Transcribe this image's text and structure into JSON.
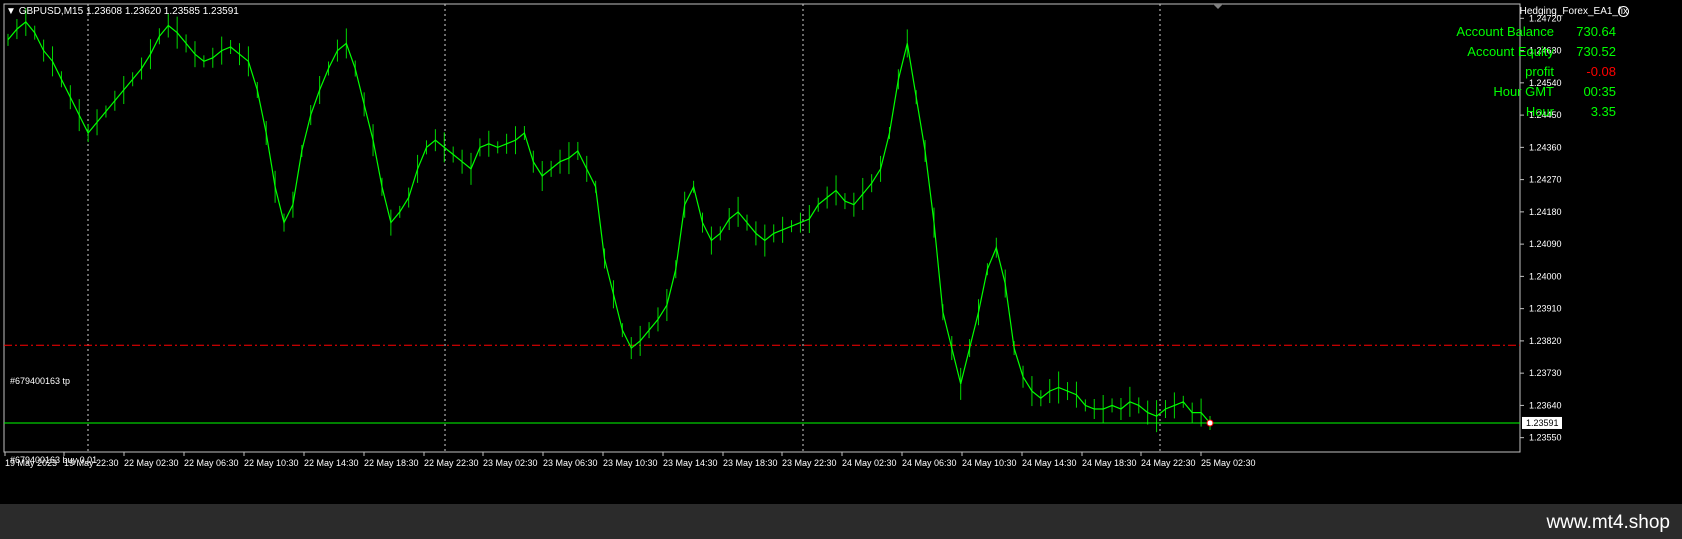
{
  "header": {
    "symbol": "GBPUSD,M15",
    "ohlc": "1.23608 1.23620 1.23585 1.23591",
    "ea_name": "Hedging_Forex_EA1_fix"
  },
  "info_panel": [
    {
      "label": "Account Balance",
      "value": "730.64",
      "negative": false
    },
    {
      "label": "Account Equity",
      "value": "730.52",
      "negative": false
    },
    {
      "label": "profit",
      "value": "-0.08",
      "negative": true
    },
    {
      "label": "Hour GMT",
      "value": "00:35",
      "negative": false
    },
    {
      "label": "Hour",
      "value": "3.35",
      "negative": false
    }
  ],
  "order_labels": {
    "tp": "#679400163 tp",
    "entry": "#679400163 buy 0.01"
  },
  "watermark": "www.mt4.shop",
  "colors": {
    "background": "#000000",
    "candles": "#00ff00",
    "tp_line": "#ff0000",
    "entry_line": "#00ff00",
    "grid": "#c0c0c0",
    "axis_text": "#ffffff"
  },
  "chart_data": {
    "type": "line",
    "title": "",
    "symbol": "GBPUSD",
    "timeframe": "M15",
    "ylim": [
      1.2351,
      1.2476
    ],
    "y_ticks": [
      "1.24720",
      "1.24630",
      "1.24540",
      "1.24450",
      "1.24360",
      "1.24270",
      "1.24180",
      "1.24090",
      "1.24000",
      "1.23910",
      "1.23820",
      "1.23730",
      "1.23640",
      "1.23550"
    ],
    "x_ticks": [
      "19 May 2023",
      "19 May 22:30",
      "22 May 02:30",
      "22 May 06:30",
      "22 May 10:30",
      "22 May 14:30",
      "22 May 18:30",
      "22 May 22:30",
      "23 May 02:30",
      "23 May 06:30",
      "23 May 10:30",
      "23 May 14:30",
      "23 May 18:30",
      "23 May 22:30",
      "24 May 02:30",
      "24 May 06:30",
      "24 May 10:30",
      "24 May 14:30",
      "24 May 18:30",
      "24 May 22:30",
      "25 May 02:30"
    ],
    "session_separators": [
      "19 May 22:30",
      "22 May 22:30",
      "23 May 22:30",
      "24 May 22:30"
    ],
    "current_price": "1.23591",
    "tp_level": 1.23808,
    "entry_level": 1.23591,
    "series": [
      {
        "values": [
          1.2466,
          1.2469,
          1.2471,
          1.2468,
          1.2463,
          1.246,
          1.2455,
          1.245,
          1.2445,
          1.244,
          1.2443,
          1.2446,
          1.2449,
          1.2452,
          1.2455,
          1.2458,
          1.2462,
          1.2467,
          1.247,
          1.2468,
          1.2465,
          1.2462,
          1.246,
          1.2461,
          1.2463,
          1.2464,
          1.2462,
          1.246,
          1.2452,
          1.244,
          1.2425,
          1.2415,
          1.242,
          1.2435,
          1.2445,
          1.2452,
          1.2458,
          1.2463,
          1.2465,
          1.2458,
          1.2448,
          1.2438,
          1.2425,
          1.2415,
          1.2418,
          1.2422,
          1.243,
          1.2436,
          1.2438,
          1.2436,
          1.2434,
          1.2432,
          1.243,
          1.2436,
          1.2437,
          1.2436,
          1.2437,
          1.2438,
          1.244,
          1.2432,
          1.2428,
          1.243,
          1.2432,
          1.2433,
          1.2435,
          1.243,
          1.2425,
          1.2405,
          1.2395,
          1.2385,
          1.238,
          1.2382,
          1.2385,
          1.2388,
          1.2392,
          1.2402,
          1.242,
          1.2425,
          1.2415,
          1.241,
          1.2412,
          1.2416,
          1.2418,
          1.2415,
          1.2412,
          1.241,
          1.2412,
          1.2413,
          1.2414,
          1.2415,
          1.2416,
          1.242,
          1.2422,
          1.2424,
          1.2421,
          1.242,
          1.2423,
          1.2426,
          1.243,
          1.244,
          1.2455,
          1.2465,
          1.245,
          1.2435,
          1.2415,
          1.239,
          1.238,
          1.237,
          1.238,
          1.239,
          1.2402,
          1.2408,
          1.2398,
          1.238,
          1.2372,
          1.2368,
          1.2366,
          1.2368,
          1.2369,
          1.2368,
          1.2367,
          1.2364,
          1.2363,
          1.2363,
          1.2364,
          1.2363,
          1.2365,
          1.2364,
          1.2362,
          1.2361,
          1.2363,
          1.2364,
          1.2365,
          1.2362,
          1.2362,
          1.23591
        ]
      }
    ]
  }
}
